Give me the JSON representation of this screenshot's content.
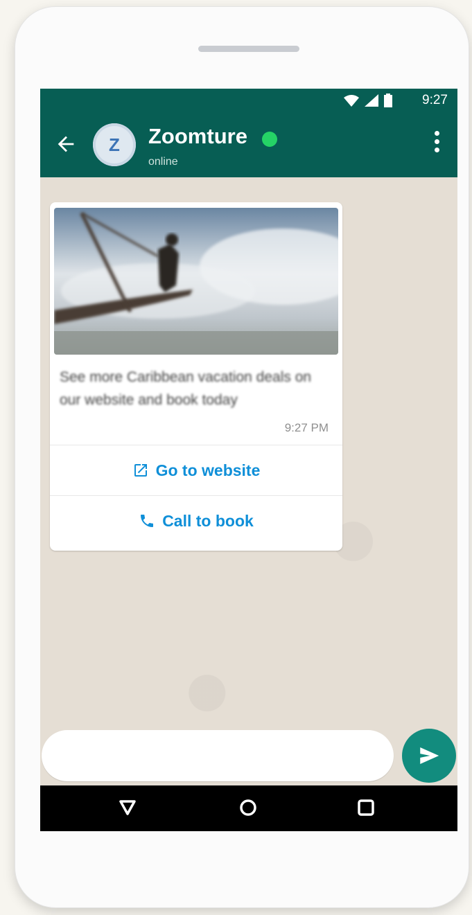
{
  "status_bar": {
    "time": "9:27"
  },
  "header": {
    "avatar_letter": "Z",
    "name": "Zoomture",
    "status": "online"
  },
  "message": {
    "caption": "See more Caribbean vacation deals on our website and book today",
    "time": "9:27 PM",
    "buttons": {
      "website": "Go to website",
      "call": "Call to book"
    }
  },
  "composer": {
    "placeholder": ""
  },
  "colors": {
    "header": "#075e54",
    "accent": "#0f8fd8",
    "send": "#128c7e",
    "verified": "#25d366"
  }
}
